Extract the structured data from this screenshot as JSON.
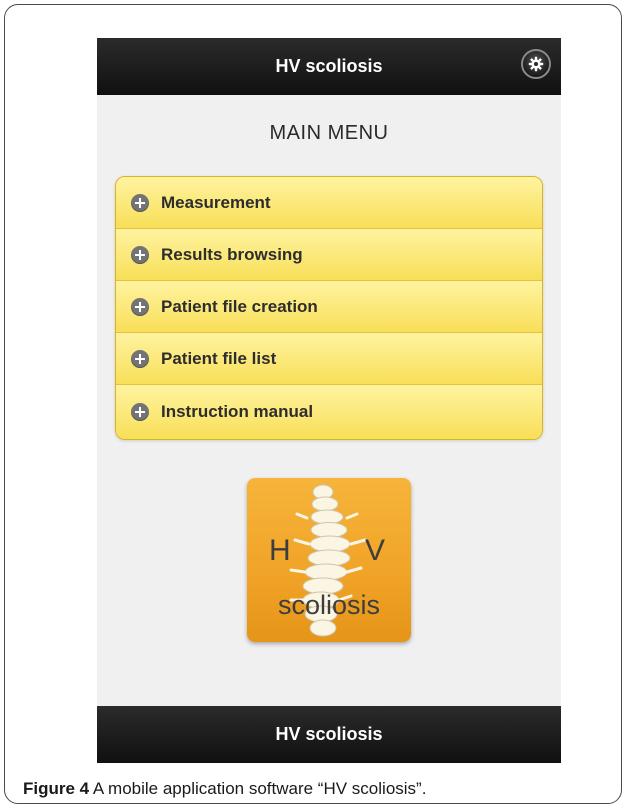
{
  "app": {
    "title": "HV scoliosis",
    "footer_title": "HV scoliosis",
    "settings_icon": "gear-icon"
  },
  "main_menu": {
    "title": "MAIN MENU",
    "items": [
      {
        "label": "Measurement",
        "icon": "plus-circle-icon"
      },
      {
        "label": "Results browsing",
        "icon": "plus-circle-icon"
      },
      {
        "label": "Patient file creation",
        "icon": "plus-circle-icon"
      },
      {
        "label": "Patient file list",
        "icon": "plus-circle-icon"
      },
      {
        "label": "Instruction manual",
        "icon": "plus-circle-icon"
      }
    ]
  },
  "logo": {
    "letter_left": "H",
    "letter_right": "V",
    "word": "scoliosis"
  },
  "caption": {
    "label": "Figure 4",
    "text": " A mobile application software “HV scoliosis”."
  },
  "colors": {
    "bar": "#151515",
    "menu_fill": "#f8df58",
    "menu_border": "#d7b421",
    "logo_fill": "#f0a327",
    "background": "#f0f0f0"
  }
}
